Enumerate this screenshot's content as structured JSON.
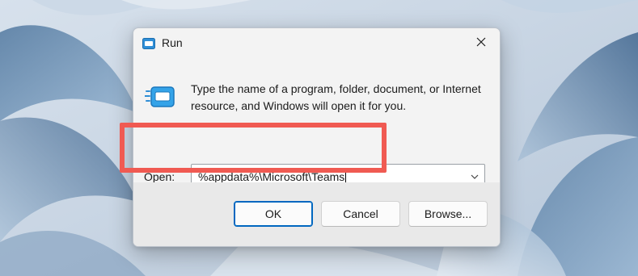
{
  "dialog": {
    "title": "Run",
    "title_icon": "run-app-icon",
    "close_icon": "close-icon",
    "description": "Type the name of a program, folder, document, or Internet resource, and Windows will open it for you.",
    "open_label": "Open:",
    "open_value": "%appdata%\\Microsoft\\Teams",
    "dropdown_icon": "chevron-down-icon",
    "buttons": {
      "ok": "OK",
      "cancel": "Cancel",
      "browse": "Browse..."
    }
  },
  "colors": {
    "highlight": "#f05a52",
    "default_button_border": "#0067c0",
    "dialog_background": "#f3f3f3",
    "footer_background": "#e9e9e9"
  }
}
